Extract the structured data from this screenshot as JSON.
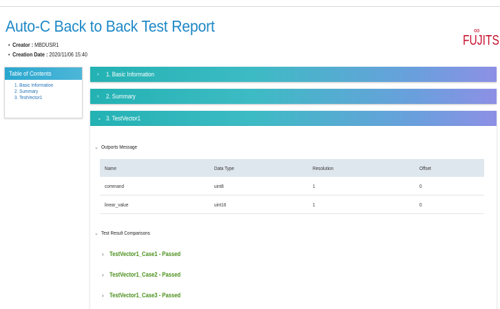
{
  "report": {
    "title": "Auto-C Back to Back Test Report",
    "creator_label": "Creator :",
    "creator_value": "MBDUSR1",
    "date_label": "Creation Date :",
    "date_value": "2020/11/06 15:40",
    "logo_text": "FUJITSU"
  },
  "toc": {
    "heading": "Table of Contents",
    "items": [
      "1. Basic Information",
      "2. Summary",
      "3. TestVector1"
    ]
  },
  "sections": [
    {
      "label": "1. Basic Information",
      "expanded": false
    },
    {
      "label": "2. Summary",
      "expanded": false
    },
    {
      "label": "3. TestVector1",
      "expanded": true
    }
  ],
  "outports": {
    "heading": "Outports Message",
    "columns": [
      "Name",
      "Data Type",
      "Resolution",
      "Offset"
    ],
    "rows": [
      [
        "command",
        "uint8",
        "1",
        "0"
      ],
      [
        "linear_value",
        "uint16",
        "1",
        "0"
      ]
    ]
  },
  "comparisons": {
    "heading": "Test Result Comparisons",
    "cases": [
      "TestVector1_Case1 - Passed",
      "TestVector1_Case2 - Passed",
      "TestVector1_Case3 - Passed"
    ]
  },
  "colors": {
    "title": "#1e88c7",
    "logo": "#c8102e",
    "passed": "#4a8f1b",
    "section_gradient_start": "#23b2b3",
    "section_gradient_end": "#8d90e5"
  },
  "icons": {
    "collapsed": "chevron-right-icon",
    "expanded": "chevron-down-icon"
  }
}
